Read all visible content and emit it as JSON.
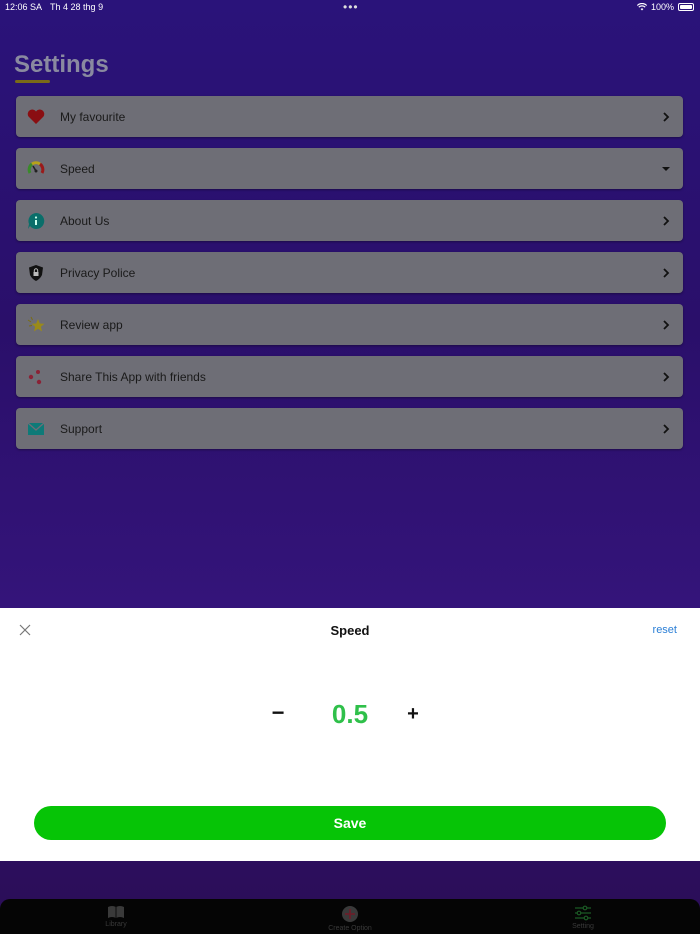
{
  "status_bar": {
    "time": "12:06 SA",
    "date": "Th 4 28 thg 9",
    "dots": "•••",
    "battery": "100%"
  },
  "page": {
    "title": "Settings"
  },
  "settings_items": [
    {
      "label": "My favourite",
      "icon": "heart-icon",
      "chevron": "chevron-right"
    },
    {
      "label": "Speed",
      "icon": "speedometer-icon",
      "chevron": "chevron-down"
    },
    {
      "label": "About Us",
      "icon": "info-icon",
      "chevron": "chevron-right"
    },
    {
      "label": "Privacy Police",
      "icon": "shield-lock-icon",
      "chevron": "chevron-right"
    },
    {
      "label": "Review app",
      "icon": "star-icon",
      "chevron": "chevron-right"
    },
    {
      "label": "Share This App with friends",
      "icon": "share-icon",
      "chevron": "chevron-right"
    },
    {
      "label": "Support",
      "icon": "mail-icon",
      "chevron": "chevron-right"
    }
  ],
  "sheet": {
    "title": "Speed",
    "reset_label": "reset",
    "minus_label": "−",
    "value": "0.5",
    "plus_label": "+",
    "save_label": "Save"
  },
  "tabbar": {
    "tabs": [
      {
        "label": "Library",
        "icon": "book-icon"
      },
      {
        "label": "Create Option",
        "icon": "add-circle-icon"
      },
      {
        "label": "Setting",
        "icon": "sliders-icon"
      }
    ]
  },
  "colors": {
    "accent_green": "#06c406",
    "value_green": "#2fc04a",
    "link_blue": "#2b7fd6",
    "background_purple": "#2a137a"
  }
}
